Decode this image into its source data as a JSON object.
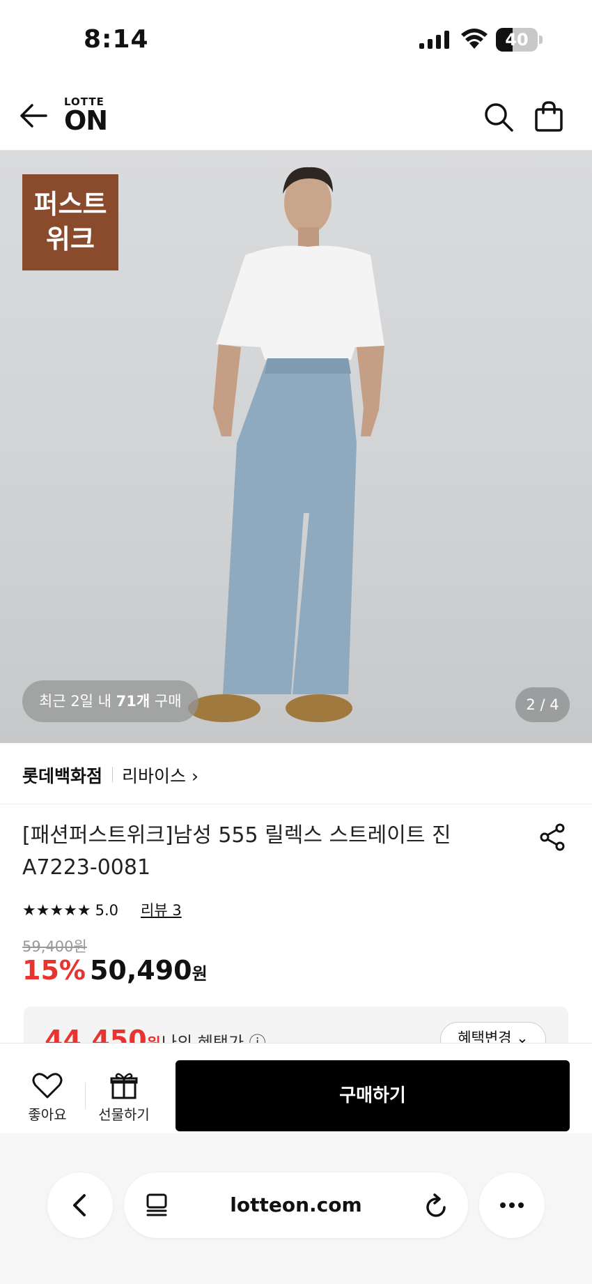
{
  "status_bar": {
    "time": "8:14",
    "battery_level": "40",
    "battery_fraction": 0.4
  },
  "header": {
    "logo_small": "LOTTE",
    "logo_big": "ON",
    "icons": [
      "back-arrow-icon",
      "search-icon",
      "shopping-bag-icon"
    ]
  },
  "hero": {
    "badge_line1": "퍼스트",
    "badge_line2": "위크",
    "buy_count_prefix": "최근 2일 내 ",
    "buy_count_bold": "71개",
    "buy_count_suffix": " 구매",
    "pager": "2 / 4",
    "badge_color": "#8a4a2c"
  },
  "product": {
    "store": "롯데백화점",
    "brand": "리바이스 ›",
    "title_line1": "[패션퍼스트위크]남성 555 릴렉스 스트레이트 진",
    "title_line2": "A7223-0081",
    "stars": "★★★★★",
    "rating": "5.0",
    "review_link": "리뷰 3",
    "original_price": "59,400원",
    "discount": "15%",
    "price": "50,490",
    "price_unit": "원",
    "benefit_price": "44,450",
    "benefit_unit": "원",
    "benefit_label": "나의 혜택가 ⓘ",
    "benefit_change": "혜택변경 ⌄",
    "discount_color": "#e8332e"
  },
  "actions": {
    "like_label": "좋아요",
    "gift_label": "선물하기",
    "buy_label": "구매하기"
  },
  "browser": {
    "url": "lotteon.com",
    "icons": [
      "chevron-left-icon",
      "tabs-icon",
      "reload-icon",
      "more-icon"
    ]
  }
}
